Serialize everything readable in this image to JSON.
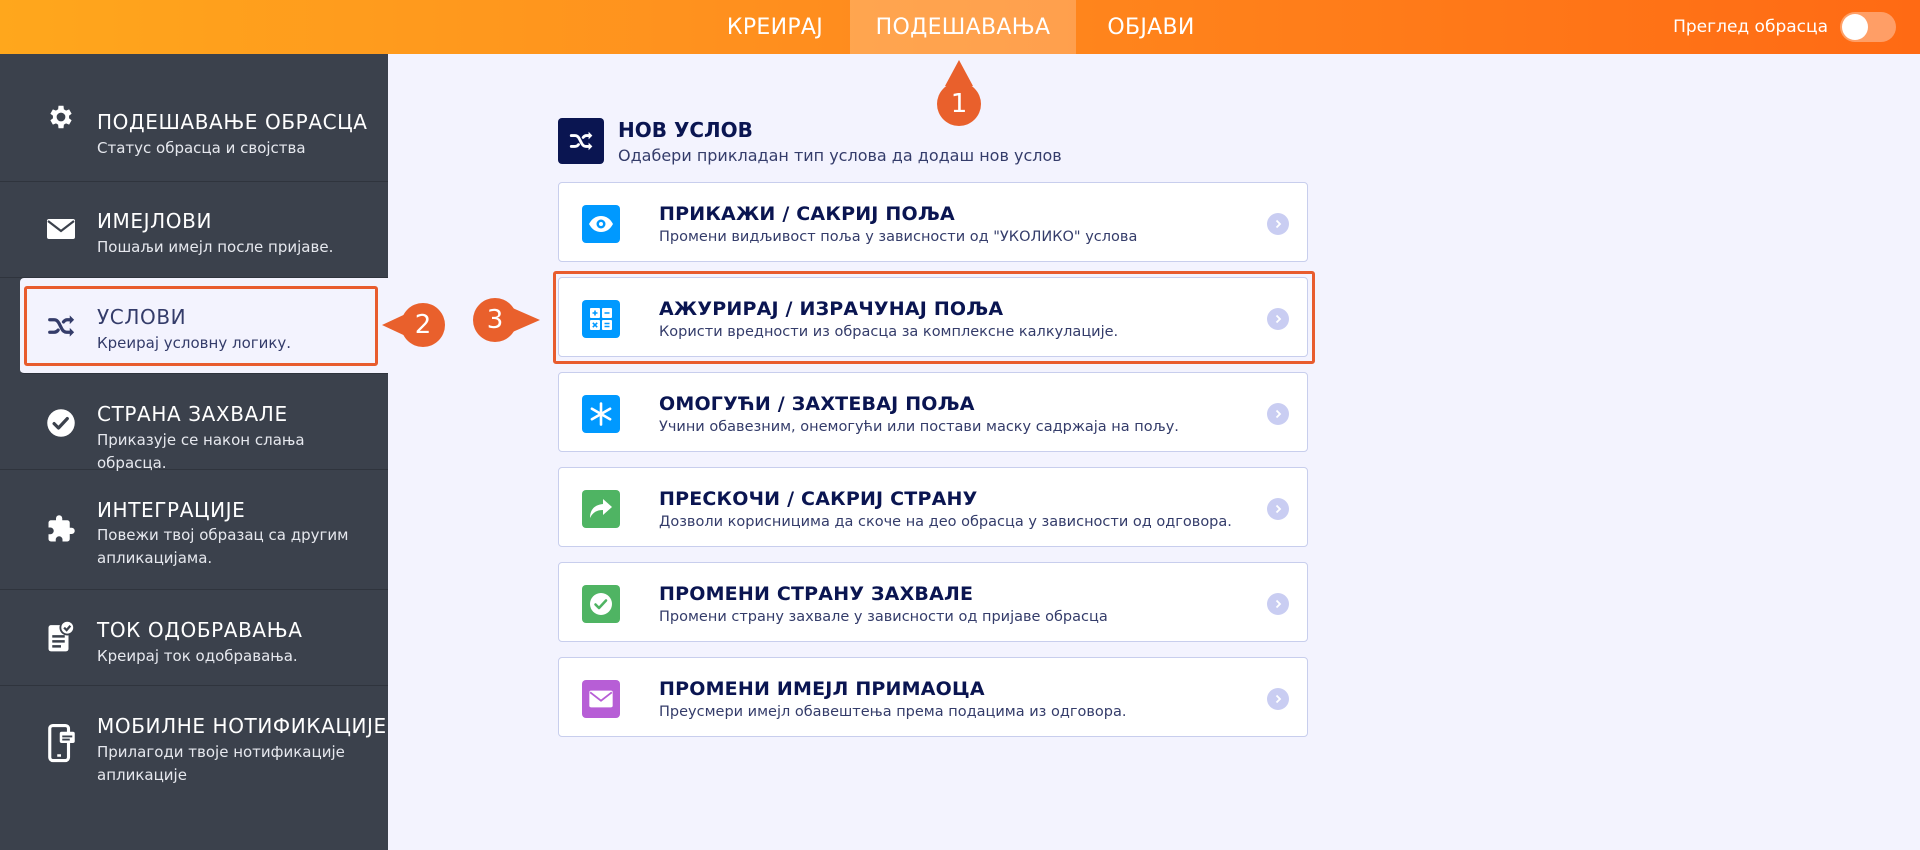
{
  "topbar": {
    "tabs": [
      {
        "label": "КРЕИРАЈ"
      },
      {
        "label": "ПОДЕШАВАЊА",
        "active": true
      },
      {
        "label": "ОБЈАВИ"
      }
    ],
    "preview_label": "Преглед обрасца",
    "preview_toggle_on": false
  },
  "sidebar": {
    "items": [
      {
        "title": "ПОДЕШАВАЊЕ ОБРАСЦА",
        "subtitle": "Статус обрасца и својства",
        "icon": "gear-icon"
      },
      {
        "title": "ИМЕЈЛОВИ",
        "subtitle": "Пошаљи имејл после пријаве.",
        "icon": "envelope-icon"
      },
      {
        "title": "УСЛОВИ",
        "subtitle": "Креирај условну логику.",
        "icon": "shuffle-icon",
        "active": true
      },
      {
        "title": "СТРАНА ЗАХВАЛЕ",
        "subtitle": "Приказује се након слања обрасца.",
        "icon": "check-circle-icon"
      },
      {
        "title": "ИНТЕГРАЦИЈЕ",
        "subtitle": "Повежи твој образац са другим апликацијама.",
        "icon": "puzzle-icon"
      },
      {
        "title": "ТОК ОДОБРАВАЊА",
        "subtitle": "Креирај ток одобравања.",
        "icon": "approval-doc-icon"
      },
      {
        "title": "МОБИЛНЕ НОТИФИКАЦИЈЕ",
        "subtitle": "Прилагоди твоје нотификације апликације",
        "icon": "mobile-notification-icon"
      }
    ]
  },
  "main": {
    "title": "НОВ УСЛОВ",
    "subtitle": "Одабери прикладан тип услова да додаш нов услов",
    "cards": [
      {
        "title": "ПРИКАЖИ / САКРИЈ ПОЉА",
        "subtitle": "Промени видљивост поља у зависности од \"УКОЛИКО\" услова",
        "icon": "eye-icon",
        "color": "#0099ff"
      },
      {
        "title": "АЖУРИРАЈ / ИЗРАЧУНАЈ ПОЉА",
        "subtitle": "Користи вредности из обрасца за комплексне калкулације.",
        "icon": "calculator-icon",
        "color": "#0099ff"
      },
      {
        "title": "ОМОГУЋИ / ЗАХТЕВАЈ ПОЉА",
        "subtitle": "Учини обавезним, онемогући или постави маску садржаја на пољу.",
        "icon": "asterisk-icon",
        "color": "#0099ff"
      },
      {
        "title": "ПРЕСКОЧИ / САКРИЈ СТРАНУ",
        "subtitle": "Дозволи корисницима да скоче на део обрасца у зависности од одговора.",
        "icon": "share-arrow-icon",
        "color": "#4fb463"
      },
      {
        "title": "ПРОМЕНИ СТРАНУ ЗАХВАЛЕ",
        "subtitle": "Промени страну захвале у зависности од пријаве обрасца",
        "icon": "check-circle-icon",
        "color": "#4fb463"
      },
      {
        "title": "ПРОМЕНИ ИМЕЈЛ ПРИМАОЦА",
        "subtitle": "Преусмери имејл обавештења према подацима из одговора.",
        "icon": "envelope-icon",
        "color": "#b75ed6"
      }
    ]
  },
  "annotations": {
    "badges": [
      "1",
      "2",
      "3"
    ],
    "color": "#e9602c"
  }
}
